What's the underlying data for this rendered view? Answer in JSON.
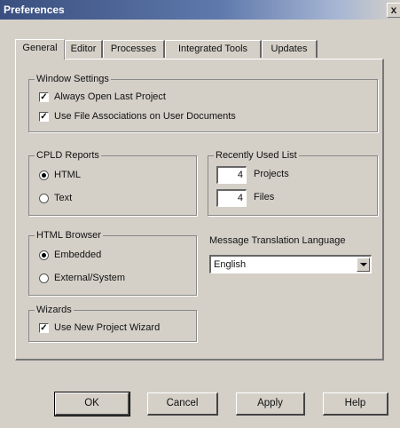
{
  "window": {
    "title": "Preferences",
    "close_glyph": "x"
  },
  "tabs": [
    {
      "label": "General"
    },
    {
      "label": "Editor"
    },
    {
      "label": "Processes"
    },
    {
      "label": "Integrated Tools"
    },
    {
      "label": "Updates"
    }
  ],
  "window_settings": {
    "label": "Window Settings",
    "always_open_last_project": {
      "label": "Always Open Last Project",
      "checked": true
    },
    "use_file_associations": {
      "label": "Use File Associations on User Documents",
      "checked": true
    }
  },
  "cpld_reports": {
    "label": "CPLD Reports",
    "options": [
      {
        "label": "HTML",
        "selected": true
      },
      {
        "label": "Text",
        "selected": false
      }
    ]
  },
  "recently_used_list": {
    "label": "Recently Used List",
    "projects": {
      "value": "4",
      "label": "Projects"
    },
    "files": {
      "value": "4",
      "label": "Files"
    }
  },
  "html_browser": {
    "label": "HTML Browser",
    "options": [
      {
        "label": "Embedded",
        "selected": true
      },
      {
        "label": "External/System",
        "selected": false
      }
    ]
  },
  "message_translation": {
    "label": "Message Translation Language",
    "value": "English"
  },
  "wizards": {
    "label": "Wizards",
    "use_new_project_wizard": {
      "label": "Use New Project Wizard",
      "checked": true
    }
  },
  "buttons": {
    "ok": "OK",
    "cancel": "Cancel",
    "apply": "Apply",
    "help": "Help"
  },
  "glyphs": {
    "check": "✓"
  }
}
